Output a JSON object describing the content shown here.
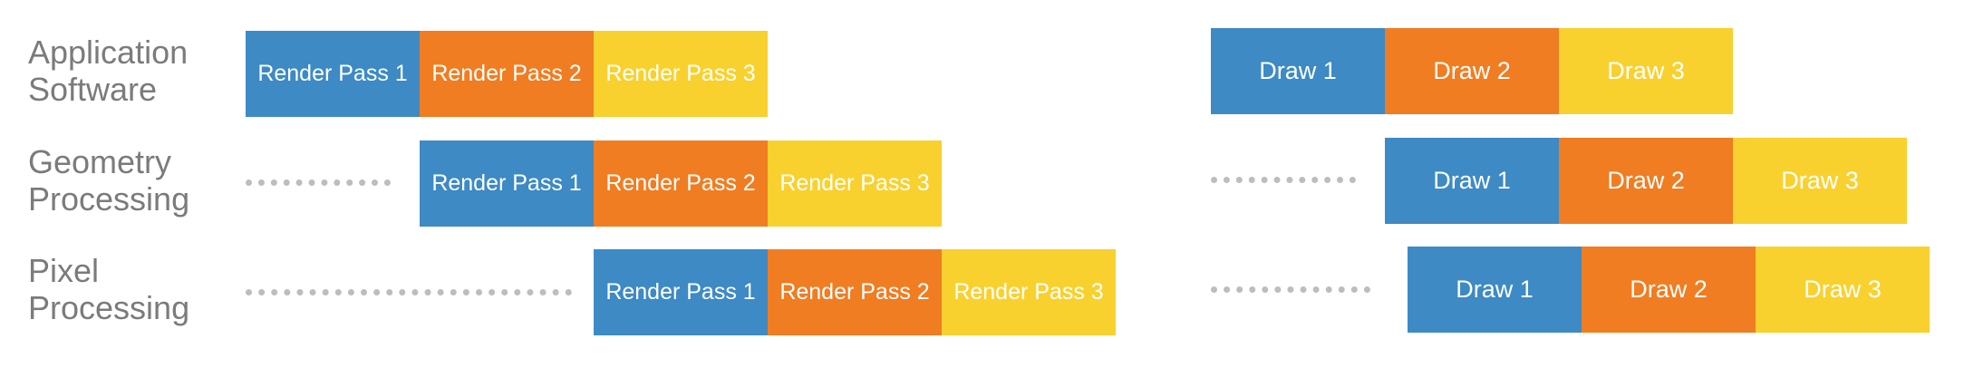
{
  "rows": [
    {
      "label": "Application\nSoftware"
    },
    {
      "label": "Geometry\nProcessing"
    },
    {
      "label": "Pixel\nProcessing"
    }
  ],
  "colors": {
    "pass1": "#3d8ac4",
    "pass2": "#f07d22",
    "pass3": "#f9d12f",
    "label_text": "#7b7b7b",
    "dots": "#bdbdbd"
  },
  "left_timeline": {
    "rows": [
      {
        "blocks": [
          "Render Pass 1",
          "Render Pass 2",
          "Render Pass 3"
        ]
      },
      {
        "blocks": [
          "Render Pass 1",
          "Render Pass 2",
          "Render Pass 3"
        ]
      },
      {
        "blocks": [
          "Render Pass 1",
          "Render Pass 2",
          "Render Pass 3"
        ]
      }
    ]
  },
  "right_timeline": {
    "rows": [
      {
        "blocks": [
          "Draw 1",
          "Draw 2",
          "Draw 3"
        ]
      },
      {
        "blocks": [
          "Draw 1",
          "Draw 2",
          "Draw 3"
        ]
      },
      {
        "blocks": [
          "Draw 1",
          "Draw 2",
          "Draw 3"
        ]
      }
    ]
  }
}
